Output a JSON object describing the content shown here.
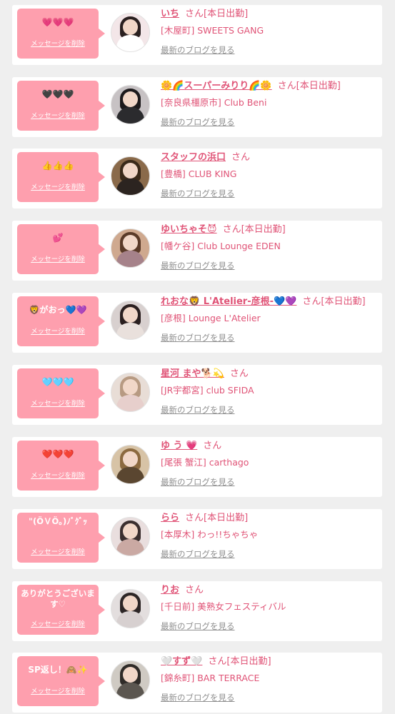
{
  "colors": {
    "page_background": "#efefef",
    "card_background": "#ffffff",
    "bubble_pink": "#fe9fae",
    "name_pink": "#e05477",
    "link_gray": "#909090"
  },
  "labels": {
    "delete_message": "メッセージを削除",
    "honorific": "さん",
    "working_today": "[本日出勤]",
    "view_blog": "最新のブログを見る"
  },
  "entries": [
    {
      "message": "💗💗💗",
      "name": "いち",
      "shop": "[木屋町] SWEETS GANG",
      "working_today": true,
      "avatar_tone": "#f3e6e8",
      "avatar_hair": "#2a2020",
      "avatar_body": "#ffffff"
    },
    {
      "message": "🖤🖤🖤",
      "name": "🌼🌈スーパーみりり🌈🌼",
      "shop": "[奈良県橿原市] Club Beni",
      "working_today": true,
      "avatar_tone": "#c7c2c4",
      "avatar_hair": "#1d1a1c",
      "avatar_body": "#2b2b2e"
    },
    {
      "message": "👍👍👍",
      "name": "スタッフの浜口",
      "shop": "[豊橋] CLUB KING",
      "working_today": false,
      "avatar_tone": "#8a6a4a",
      "avatar_hair": "#3a2a1a",
      "avatar_body": "#2c2420"
    },
    {
      "message": "💕",
      "name": "ゆいちゃそ😈",
      "shop": "[幡ケ谷] Club Lounge EDEN",
      "working_today": true,
      "avatar_tone": "#cfa98f",
      "avatar_hair": "#5a3a28",
      "avatar_body": "#a6828a"
    },
    {
      "message": "🦁がおっ💙💜",
      "name": "れおな🦁 L'Atelier-彦根-💙💜",
      "shop": "[彦根] Lounge L'Atelier",
      "working_today": true,
      "avatar_tone": "#d8d0cf",
      "avatar_hair": "#2a1f1f",
      "avatar_body": "#e9e0dc"
    },
    {
      "message": "🩵🩵🩵",
      "name": "星河 まや🐕💫",
      "shop": "[JR宇都宮] club SFIDA",
      "working_today": false,
      "avatar_tone": "#e8ddd6",
      "avatar_hair": "#b79a82",
      "avatar_body": "#e7cfcc"
    },
    {
      "message": "❤️❤️❤️",
      "name": "ゆ う 💗",
      "shop": "[尾張 蟹江] carthago",
      "working_today": false,
      "avatar_tone": "#d7c3a6",
      "avatar_hair": "#8c6a40",
      "avatar_body": "#5a4630"
    },
    {
      "message": "\"(ӦＶӦ｡)ﾉﾞｸﾞｯ",
      "name": "らら",
      "shop": "[本厚木] わっ!!ちゃちゃ",
      "working_today": true,
      "avatar_tone": "#e9dede",
      "avatar_hair": "#3b2f2f",
      "avatar_body": "#caa9a3"
    },
    {
      "message": "ありがとうございます♡",
      "name": "りお",
      "shop": "[千日前] 美熟女フェスティバル",
      "working_today": false,
      "avatar_tone": "#e3dede",
      "avatar_hair": "#2d2626",
      "avatar_body": "#d7d0d0"
    },
    {
      "message": "SP返し！🙈✨",
      "name": "🤍すず🤍",
      "shop": "[錦糸町] BAR TERRACE",
      "working_today": true,
      "avatar_tone": "#cfcac3",
      "avatar_hair": "#2f2b28",
      "avatar_body": "#5b5650"
    }
  ]
}
